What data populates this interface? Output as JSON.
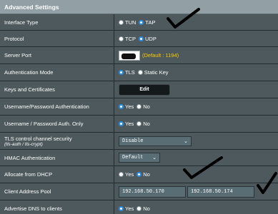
{
  "header": {
    "title": "Advanced Settings"
  },
  "rows": {
    "interface_type": {
      "label": "Interface Type",
      "options": [
        "TUN",
        "TAP"
      ],
      "selected": "TAP"
    },
    "protocol": {
      "label": "Protocol",
      "options": [
        "TCP",
        "UDP"
      ],
      "selected": "UDP"
    },
    "server_port": {
      "label": "Server Port",
      "hint": "(Default : 1194)"
    },
    "auth_mode": {
      "label": "Authentication Mode",
      "options": [
        "TLS",
        "Static Key"
      ],
      "selected": "TLS"
    },
    "keys_certs": {
      "label": "Keys and Certificates",
      "button": "Edit"
    },
    "userpass_auth": {
      "label": "Username/Password Authentication",
      "options": [
        "Yes",
        "No"
      ],
      "selected": "Yes"
    },
    "userpass_only": {
      "label": "Username / Password Auth. Only",
      "options": [
        "Yes",
        "No"
      ],
      "selected": "Yes"
    },
    "tls_control": {
      "label": "TLS control channel security",
      "sublabel": "(tls-auth / tls-crypt)",
      "value": "Disable"
    },
    "hmac": {
      "label": "HMAC Authentication",
      "value": "Default"
    },
    "dhcp": {
      "label": "Allocate from DHCP",
      "options": [
        "Yes",
        "No"
      ],
      "selected": "No"
    },
    "client_pool": {
      "label": "Client Address Pool",
      "start": "192.168.50.170",
      "end": "192.168.50.174"
    },
    "advertise_dns": {
      "label": "Advertise DNS to clients",
      "options": [
        "Yes",
        "No"
      ],
      "selected": "Yes"
    }
  },
  "colors": {
    "panel": "#4d595d",
    "header": "#92a0a5",
    "accent": "#2b8ce6",
    "hint": "#ffcc00"
  }
}
